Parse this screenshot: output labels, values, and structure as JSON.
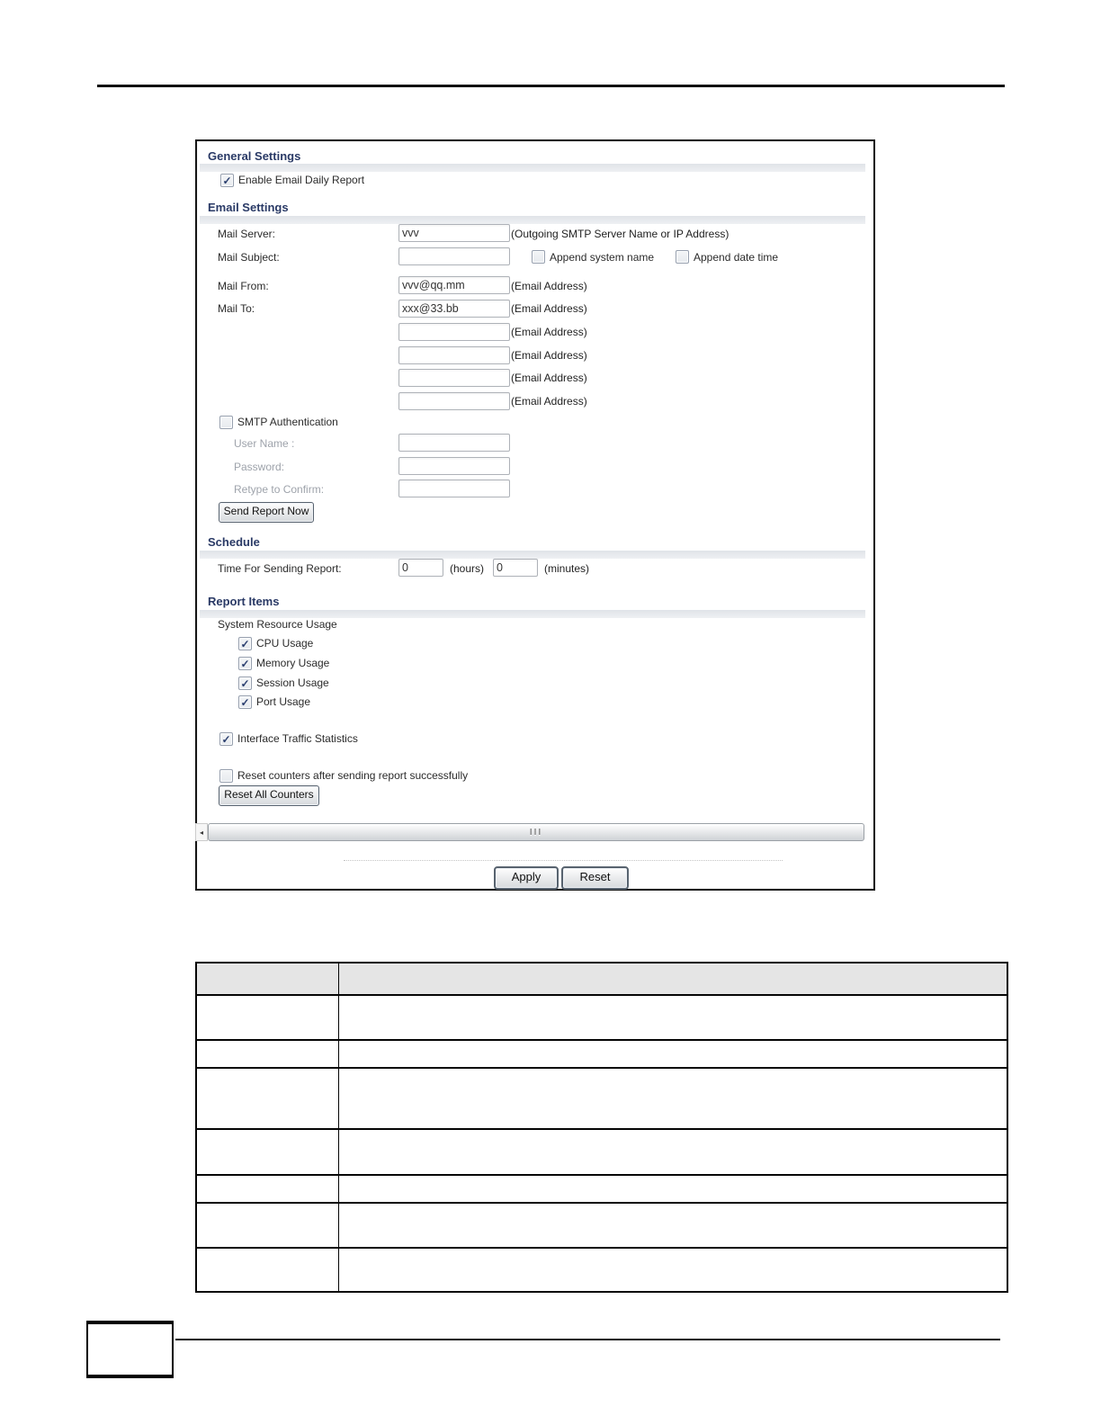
{
  "figure": {
    "general": {
      "title": "General Settings",
      "enable": {
        "label": "Enable Email Daily Report",
        "mark": "✓"
      }
    },
    "email": {
      "title": "Email Settings",
      "mail_server": {
        "label": "Mail Server:",
        "value": "vvv",
        "hint": "(Outgoing SMTP Server Name or IP Address)"
      },
      "mail_subject": {
        "label": "Mail Subject:",
        "value": "",
        "append_system": {
          "label": "Append system name",
          "mark": ""
        },
        "append_date": {
          "label": "Append date time",
          "mark": ""
        }
      },
      "mail_from": {
        "label": "Mail From:",
        "value": "vvv@qq.mm",
        "hint": "(Email Address)"
      },
      "mail_to": {
        "label": "Mail To:",
        "hint": "(Email Address)",
        "values": [
          "xxx@33.bb",
          "",
          "",
          "",
          ""
        ]
      },
      "smtp_auth": {
        "label": "SMTP Authentication",
        "mark": ""
      },
      "user_name": {
        "label": "User Name :",
        "value": ""
      },
      "password": {
        "label": "Password:",
        "value": ""
      },
      "retype": {
        "label": "Retype to Confirm:",
        "value": ""
      },
      "send_button": "Send Report Now"
    },
    "schedule": {
      "title": "Schedule",
      "label": "Time For Sending Report:",
      "hours_value": "0",
      "hours_hint": "(hours)",
      "minutes_value": "0",
      "minutes_hint": "(minutes)"
    },
    "report": {
      "title": "Report Items",
      "group_label": "System Resource Usage",
      "items": [
        {
          "label": "CPU Usage",
          "mark": "✓"
        },
        {
          "label": "Memory Usage",
          "mark": "✓"
        },
        {
          "label": "Session Usage",
          "mark": "✓"
        },
        {
          "label": "Port Usage",
          "mark": "✓"
        }
      ],
      "interface_traffic": {
        "label": "Interface Traffic Statistics",
        "mark": "✓"
      },
      "reset_counters": {
        "label": "Reset counters after sending report successfully",
        "mark": ""
      },
      "reset_button": "Reset All Counters"
    },
    "scrollbar": {
      "left_arrow": "◂",
      "grip": "III"
    },
    "buttons": {
      "apply": "Apply",
      "reset": "Reset"
    }
  },
  "table": {
    "header": [
      "",
      ""
    ],
    "rows": [
      [
        "",
        ""
      ],
      [
        "",
        ""
      ],
      [
        "",
        ""
      ],
      [
        "",
        ""
      ],
      [
        "",
        ""
      ],
      [
        "",
        ""
      ],
      [
        "",
        ""
      ]
    ]
  }
}
